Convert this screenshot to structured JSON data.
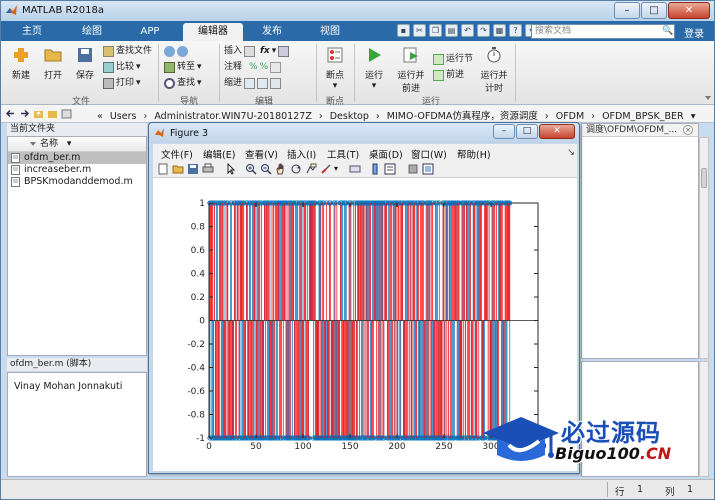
{
  "app": {
    "title": "MATLAB R2018a"
  },
  "window_buttons": {
    "minimize": "–",
    "maximize": "□",
    "close": "✕"
  },
  "ribbon_tabs": [
    "主页",
    "绘图",
    "APP",
    "编辑器",
    "发布",
    "视图"
  ],
  "active_tab": "编辑器",
  "search": {
    "placeholder": "搜索文档",
    "login": "登录"
  },
  "ribbon": {
    "file_group": {
      "label": "文件",
      "new": "新建",
      "open": "打开",
      "save": "保存",
      "find_files": "查找文件",
      "compare": "比较",
      "print": "打印"
    },
    "navigate_group": {
      "label": "导航",
      "goto": "转至",
      "find": "查找"
    },
    "edit_group": {
      "label": "编辑",
      "insert": "插入",
      "comment": "注释",
      "indent": "缩进",
      "fx": "fx"
    },
    "breakpoint_group": {
      "label": "断点",
      "breakpoints": "断点"
    },
    "run_group": {
      "label": "运行",
      "run": "运行",
      "run_advance_1": "运行并",
      "run_advance_2": "前进",
      "run_section": "运行节",
      "advance": "前进",
      "run_time_1": "运行并",
      "run_time_2": "计时"
    }
  },
  "breadcrumb": [
    "«",
    "Users",
    "›",
    "Administrator.WIN7U-20180127Z",
    "›",
    "Desktop",
    "›",
    "MIMO-OFDMA仿真程序，资源调度",
    "›",
    "OFDM",
    "›",
    "OFDM_BPSK_BER",
    "▾"
  ],
  "current_folder": {
    "title": "当前文件夹",
    "column": "名称",
    "files": [
      "ofdm_ber.m",
      "increaseber.m",
      "BPSKmodanddemod.m"
    ],
    "selected": "ofdm_ber.m"
  },
  "details": {
    "title": "ofdm_ber.m  (脚本)",
    "author": "Vinay Mohan Jonnakuti"
  },
  "right_panel": {
    "path_fragment": "调度\\OFDM\\OFDM_..."
  },
  "status": {
    "row_label": "行",
    "row_value": "1",
    "col_label": "列",
    "col_value": "1"
  },
  "figure": {
    "title": "Figure 3",
    "menu": [
      "文件(F)",
      "编辑(E)",
      "查看(V)",
      "插入(I)",
      "工具(T)",
      "桌面(D)",
      "窗口(W)",
      "帮助(H)"
    ]
  },
  "chart_data": {
    "type": "stem",
    "title": "",
    "xlabel": "",
    "ylabel": "",
    "xlim": [
      0,
      350
    ],
    "ylim": [
      -1,
      1
    ],
    "xticks": [
      0,
      50,
      100,
      150,
      200,
      250,
      300,
      350
    ],
    "yticks": [
      -1,
      -0.8,
      -0.6,
      -0.4,
      -0.2,
      0,
      0.2,
      0.4,
      0.6,
      0.8,
      1
    ],
    "series": [
      {
        "n_points": 320,
        "values_description_note": "",
        "color": "#0072bd",
        "values_seed": 7
      },
      {
        "n_points": 320,
        "color": "#ff0000",
        "values_seed": 13
      }
    ]
  },
  "watermark": {
    "main": "必过源码",
    "sub_prefix": "Biguo100",
    "sub_suffix": ".CN"
  },
  "colors": {
    "ribbon_blue": "#2a6aa8",
    "stem_blue": "#0072bd",
    "stem_red": "#ff0000",
    "watermark_blue": "#1a4fb8"
  }
}
